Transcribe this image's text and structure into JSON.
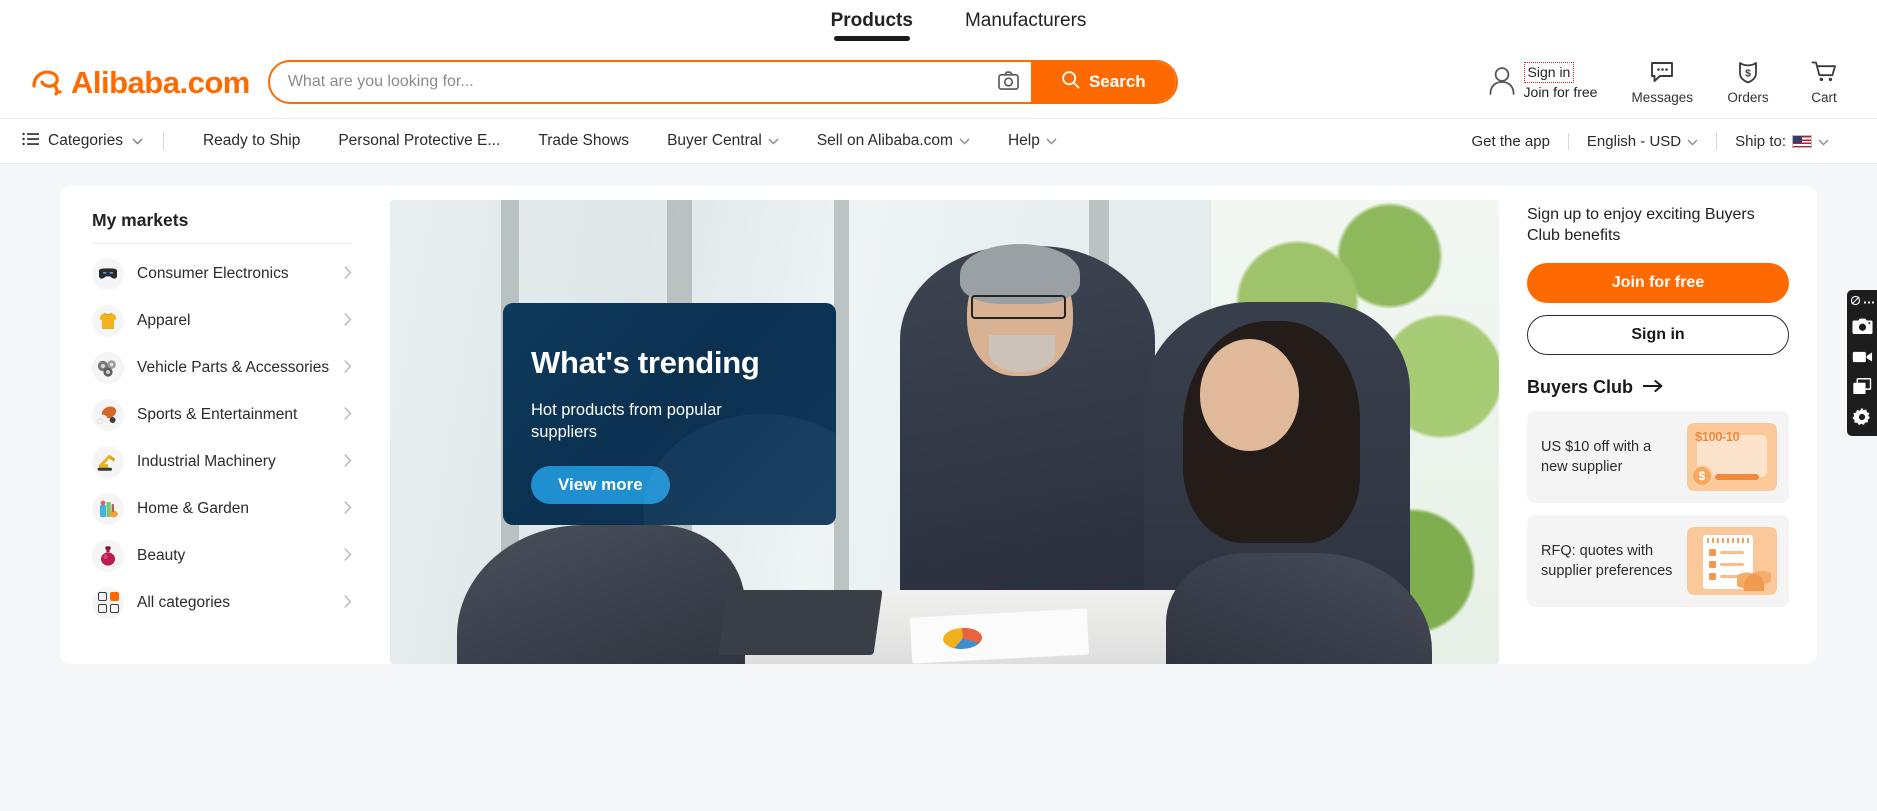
{
  "top_tabs": [
    {
      "label": "Products",
      "active": true
    },
    {
      "label": "Manufacturers",
      "active": false
    }
  ],
  "brand": {
    "name": "Alibaba",
    "suffix": ".com",
    "accent": "#ff6a00"
  },
  "search": {
    "placeholder": "What are you looking for...",
    "value": "",
    "button_label": "Search",
    "camera_icon": "camera-icon",
    "search_icon": "search-icon"
  },
  "header_actions": {
    "account": {
      "sign_in": "Sign in",
      "join": "Join for free",
      "icon": "user-icon",
      "highlight_color": "#e02b20"
    },
    "items": [
      {
        "label": "Messages",
        "icon": "chat-bubble-icon"
      },
      {
        "label": "Orders",
        "icon": "order-bag-icon"
      },
      {
        "label": "Cart",
        "icon": "cart-icon"
      }
    ]
  },
  "nav": {
    "categories_label": "Categories",
    "left_items": [
      {
        "label": "Ready to Ship",
        "has_caret": false
      },
      {
        "label": "Personal Protective E...",
        "has_caret": false
      },
      {
        "label": "Trade Shows",
        "has_caret": false
      },
      {
        "label": "Buyer Central",
        "has_caret": true
      },
      {
        "label": "Sell on Alibaba.com",
        "has_caret": true
      },
      {
        "label": "Help",
        "has_caret": true
      }
    ],
    "right_items": [
      {
        "label": "Get the app",
        "has_caret": false,
        "has_flag": false
      },
      {
        "label": "English - USD",
        "has_caret": true,
        "has_flag": false
      },
      {
        "label": "Ship to:",
        "has_caret": true,
        "has_flag": true
      }
    ]
  },
  "sidebar": {
    "title": "My markets",
    "items": [
      {
        "label": "Consumer Electronics",
        "icon": "vr-headset-icon",
        "glyph": "🥽"
      },
      {
        "label": "Apparel",
        "icon": "tshirt-icon",
        "glyph": "👕"
      },
      {
        "label": "Vehicle Parts & Accessories",
        "icon": "vehicle-parts-icon",
        "glyph": "⚙"
      },
      {
        "label": "Sports & Entertainment",
        "icon": "sports-ball-icon",
        "glyph": "🏀"
      },
      {
        "label": "Industrial Machinery",
        "icon": "excavator-icon",
        "glyph": "🚧"
      },
      {
        "label": "Home & Garden",
        "icon": "home-garden-icon",
        "glyph": "🧴"
      },
      {
        "label": "Beauty",
        "icon": "perfume-bottle-icon",
        "glyph": "🍷"
      },
      {
        "label": "All categories",
        "icon": "grid-icon",
        "glyph": ""
      }
    ]
  },
  "hero": {
    "title": "What's trending",
    "subtitle": "Hot products from popular suppliers",
    "button_label": "View more",
    "overlay_color": "#0b3050",
    "button_color": "#1f8fd0",
    "carousel": {
      "total": 6,
      "active_index": 4,
      "active_color": "#ff6a00"
    }
  },
  "right_panel": {
    "signup_text": "Sign up to enjoy exciting Buyers Club benefits",
    "join_label": "Join for free",
    "signin_label": "Sign in",
    "club_title": "Buyers Club",
    "club_arrow": "→",
    "promos": [
      {
        "text": "US $10 off with a new supplier",
        "art": "coupon-art",
        "coupon_label": "$100-10",
        "coin_glyph": "$"
      },
      {
        "text": "RFQ: quotes with supplier preferences",
        "art": "rfq-note-art",
        "coupon_label": "",
        "coin_glyph": ""
      }
    ]
  },
  "float_toolbar": {
    "items": [
      {
        "icon": "screenshot-region-icon",
        "label": "Capture region"
      },
      {
        "icon": "camera-icon",
        "label": "Screenshot"
      },
      {
        "icon": "video-camera-icon",
        "label": "Record video"
      },
      {
        "icon": "windows-icon",
        "label": "Windows"
      },
      {
        "icon": "gear-icon",
        "label": "Settings"
      }
    ]
  }
}
